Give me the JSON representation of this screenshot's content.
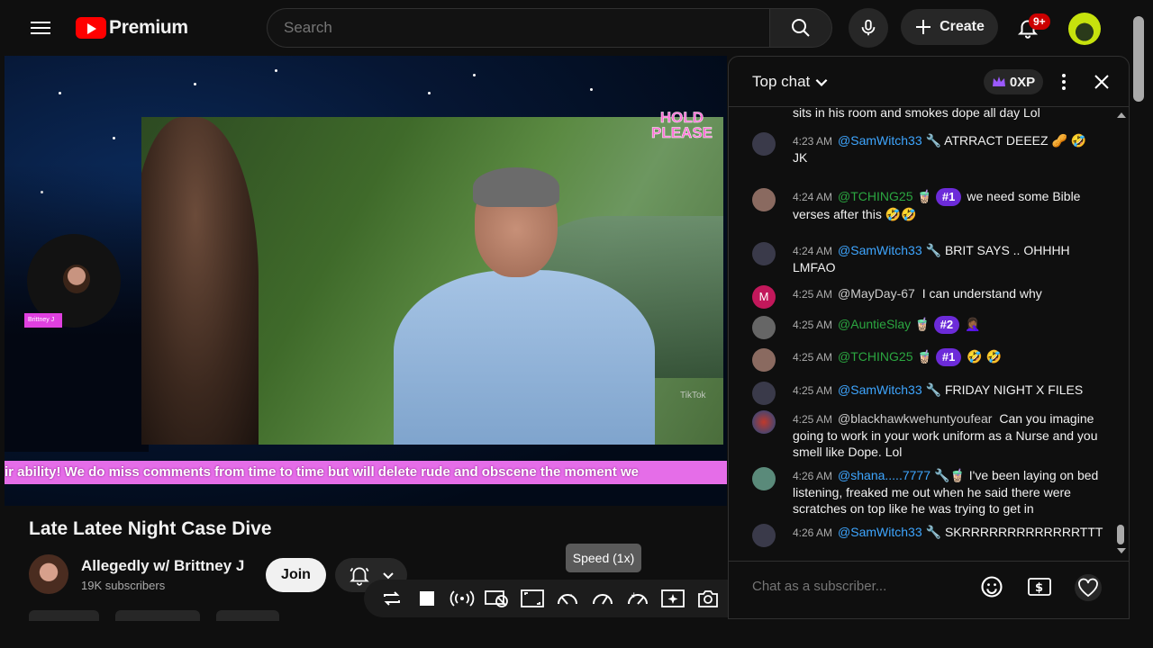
{
  "brand": {
    "logo_text": "Premium",
    "accent": "#ff0000"
  },
  "search": {
    "placeholder": "Search"
  },
  "header": {
    "create_label": "Create",
    "notification_count": "9+"
  },
  "video": {
    "title": "Late Latee Night Case Dive",
    "overlay_label": "HOLD PLEASE",
    "host_name": "Brittney J",
    "tiktok_mark": "TikTok",
    "ticker_text": "ir ability! We do miss comments from time to time but will delete rude and obscene the moment we"
  },
  "channel": {
    "name": "Allegedly w/ Brittney J",
    "subscribers": "19K subscribers",
    "join_label": "Join"
  },
  "tooltip": {
    "speed": "Speed (1x)"
  },
  "toolbar": {
    "icons": [
      "loop-icon",
      "stop-icon",
      "broadcast-icon",
      "hide-icon",
      "fullscreen-icon",
      "speed-down-icon",
      "speed-icon",
      "speed-up-icon",
      "sparkle-icon",
      "screenshot-icon",
      "settings-icon"
    ]
  },
  "chat": {
    "mode": "Top chat",
    "xp": "0XP",
    "input_placeholder": "Chat as a subscriber...",
    "partial_message": "sits in his room and smokes dope all day Lol",
    "messages": [
      {
        "time": "4:23 AM",
        "author": "@SamWitch33",
        "author_badge": "🔧",
        "rank": "",
        "text": "ATRRACT DEEEZ 🥜 🤣 JK"
      },
      {
        "time": "4:24 AM",
        "author": "@TCHING25",
        "author_badge": "🧋",
        "rank": "#1",
        "text": "we need some Bible verses after this 🤣🤣"
      },
      {
        "time": "4:24 AM",
        "author": "@SamWitch33",
        "author_badge": "🔧",
        "rank": "",
        "text": "BRIT SAYS .. OHHHH LMFAO"
      },
      {
        "time": "4:25 AM",
        "author": "@MayDay-67",
        "author_badge": "",
        "rank": "",
        "text": "I can understand why"
      },
      {
        "time": "4:25 AM",
        "author": "@AuntieSlay",
        "author_badge": "🧋",
        "rank": "#2",
        "text": "🤦🏾‍♀️"
      },
      {
        "time": "4:25 AM",
        "author": "@TCHING25",
        "author_badge": "🧋",
        "rank": "#1",
        "text": "🤣 🤣"
      },
      {
        "time": "4:25 AM",
        "author": "@SamWitch33",
        "author_badge": "🔧",
        "rank": "",
        "text": "FRIDAY NIGHT X FILES"
      },
      {
        "time": "4:25 AM",
        "author": "@blackhawkwehuntyoufear",
        "author_badge": "",
        "rank": "",
        "text": "Can you imagine going to work in your work uniform as a Nurse and you smell like Dope. Lol"
      },
      {
        "time": "4:26 AM",
        "author": "@shana.....7777",
        "author_badge": "🔧🧋",
        "rank": "",
        "text": "I've been laying on bed listening, freaked me out when he said there were scratches on top like he was trying to get in"
      },
      {
        "time": "4:26 AM",
        "author": "@SamWitch33",
        "author_badge": "🔧",
        "rank": "",
        "text": "SKRRRRRRRRRRRRRTTT"
      }
    ]
  }
}
